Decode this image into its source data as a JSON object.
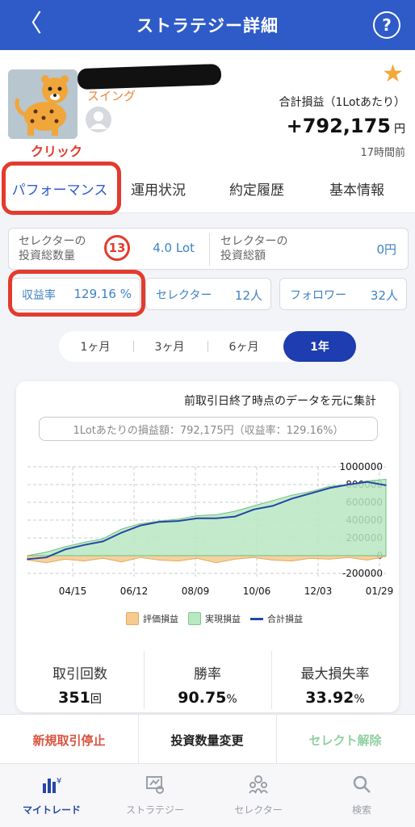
{
  "header": {
    "title": "ストラテジー詳細",
    "back_glyph": "〈",
    "help_glyph": "?"
  },
  "profile": {
    "category": "スイング",
    "click_annotation": "クリック",
    "total_label": "合計損益（1Lotあたり）",
    "total_value": "+792,175",
    "total_unit": "円",
    "updated": "17時間前"
  },
  "tabs": [
    {
      "label": "パフォーマンス",
      "active": true
    },
    {
      "label": "運用状況",
      "active": false
    },
    {
      "label": "約定履歴",
      "active": false
    },
    {
      "label": "基本情報",
      "active": false
    }
  ],
  "stats": {
    "invest_qty_label_1": "セレクターの",
    "invest_qty_label_2": "投資総数量",
    "invest_qty_badge": "13",
    "invest_qty_value": "4.0 Lot",
    "invest_amt_label_1": "セレクターの",
    "invest_amt_label_2": "投資総額",
    "invest_amt_value": "0円",
    "yield_label": "収益率",
    "yield_value": "129.16 %",
    "selector_label": "セレクター",
    "selector_value": "12人",
    "follower_label": "フォロワー",
    "follower_value": "32人"
  },
  "periods": [
    {
      "label": "1ヶ月",
      "active": false
    },
    {
      "label": "3ヶ月",
      "active": false
    },
    {
      "label": "6ヶ月",
      "active": false
    },
    {
      "label": "1年",
      "active": true
    }
  ],
  "card": {
    "title": "前取引日終了時点のデータを元に集計",
    "summary": "1Lotあたりの損益額：792,175円（収益率：129.16%）"
  },
  "chart_data": {
    "type": "area",
    "x": [
      "04/15",
      "06/12",
      "08/09",
      "10/06",
      "12/03",
      "01/29"
    ],
    "yticks": [
      "1000000",
      "800000",
      "600000",
      "400000",
      "200000",
      "0",
      "-200000"
    ],
    "ylim": [
      -200000,
      1000000
    ],
    "grid": true,
    "legend_position": "bottom",
    "series": [
      {
        "name": "評価損益",
        "color": "#f5c98f",
        "values": [
          -50000,
          -80000,
          -40000,
          -60000,
          -30000,
          -70000,
          -20000,
          -50000,
          -60000,
          -30000,
          -80000,
          -40000,
          -20000,
          -50000,
          -60000,
          -30000,
          -40000,
          -20000,
          -50000,
          -10000
        ]
      },
      {
        "name": "実現損益",
        "color": "#b9e7c2",
        "values": [
          0,
          40000,
          100000,
          150000,
          190000,
          300000,
          360000,
          390000,
          410000,
          450000,
          460000,
          500000,
          560000,
          620000,
          680000,
          720000,
          780000,
          800000,
          840000,
          860000
        ]
      },
      {
        "name": "合計損益",
        "color": "#2447a6",
        "values": [
          -40000,
          -20000,
          70000,
          120000,
          160000,
          260000,
          340000,
          380000,
          390000,
          420000,
          420000,
          440000,
          520000,
          560000,
          640000,
          700000,
          760000,
          800000,
          830000,
          792175
        ]
      }
    ]
  },
  "metrics": [
    {
      "label": "取引回数",
      "value": "351",
      "unit": "回"
    },
    {
      "label": "勝率",
      "value": "90.75",
      "unit": "%"
    },
    {
      "label": "最大損失率",
      "value": "33.92",
      "unit": "%"
    }
  ],
  "actions": [
    {
      "label": "新規取引停止",
      "color": "#d9543f"
    },
    {
      "label": "投資数量変更",
      "color": "#222222"
    },
    {
      "label": "セレクト解除",
      "color": "#8fd0a0"
    }
  ],
  "nav": [
    {
      "label": "マイトレード",
      "icon": "mytrade-icon",
      "active": true
    },
    {
      "label": "ストラテジー",
      "icon": "strategy-icon",
      "active": false
    },
    {
      "label": "セレクター",
      "icon": "selector-icon",
      "active": false
    },
    {
      "label": "検索",
      "icon": "search-icon",
      "active": false
    }
  ]
}
